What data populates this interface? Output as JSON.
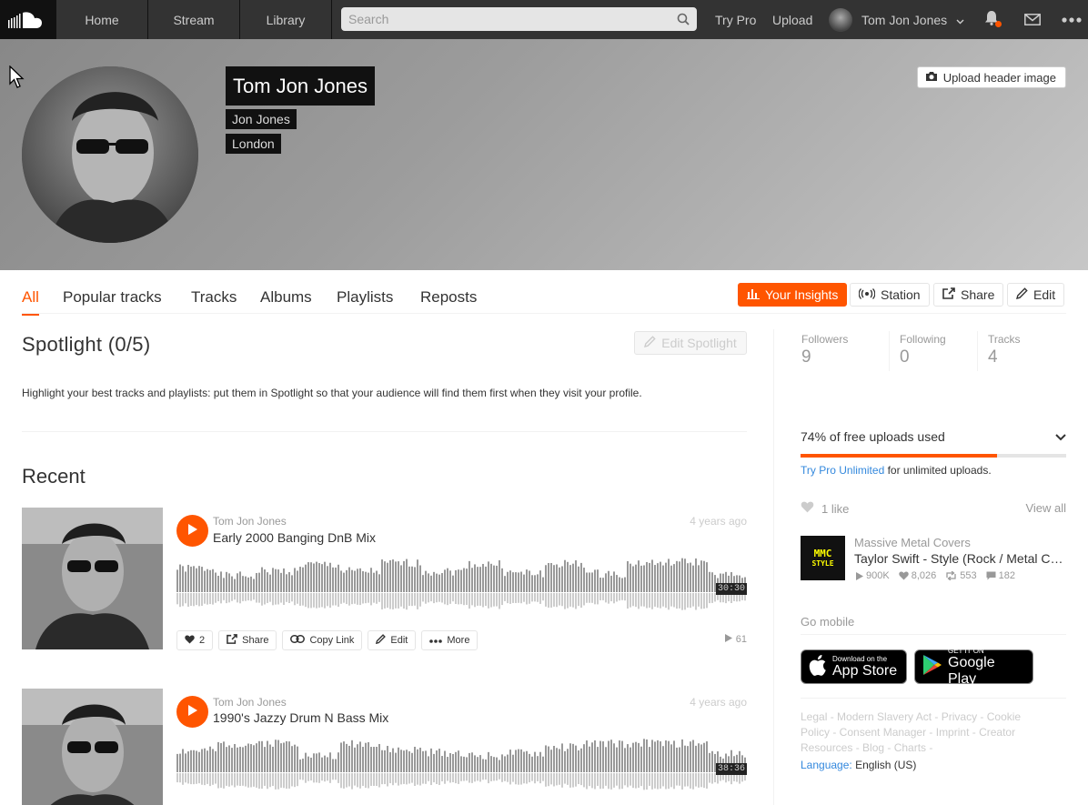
{
  "nav": {
    "home": "Home",
    "stream": "Stream",
    "library": "Library",
    "search_placeholder": "Search",
    "try_pro": "Try Pro",
    "upload": "Upload",
    "user_name": "Tom Jon Jones"
  },
  "profile": {
    "display_name": "Tom Jon Jones",
    "full_name": "Jon Jones",
    "city": "London",
    "upload_header_label": "Upload header image"
  },
  "tabs": {
    "all": "All",
    "popular": "Popular tracks",
    "tracks": "Tracks",
    "albums": "Albums",
    "playlists": "Playlists",
    "reposts": "Reposts"
  },
  "actions": {
    "insights": "Your Insights",
    "station": "Station",
    "share": "Share",
    "edit": "Edit"
  },
  "spotlight": {
    "title": "Spotlight (0/5)",
    "edit_label": "Edit Spotlight",
    "description": "Highlight your best tracks and playlists: put them in Spotlight so that your audience will find them first when they visit your profile."
  },
  "recent": {
    "title": "Recent",
    "tracks": [
      {
        "user": "Tom Jon Jones",
        "title": "Early 2000 Banging DnB Mix",
        "age": "4 years ago",
        "duration": "30:30",
        "likes": "2",
        "plays": "61",
        "share": "Share",
        "copy": "Copy Link",
        "edit": "Edit",
        "more": "More"
      },
      {
        "user": "Tom Jon Jones",
        "title": "1990's Jazzy Drum N Bass Mix",
        "age": "4 years ago",
        "duration": "38:36"
      }
    ]
  },
  "stats": {
    "followers_label": "Followers",
    "followers": "9",
    "following_label": "Following",
    "following": "0",
    "tracks_label": "Tracks",
    "tracks": "4"
  },
  "uploads": {
    "label": "74% of free uploads used",
    "percent": 74,
    "pro_link": "Try Pro Unlimited",
    "pro_suffix": "for unlimited uploads."
  },
  "likes": {
    "count_label": "1 like",
    "view_all": "View all",
    "item": {
      "art_text_1": "MMC",
      "art_text_2": "STYLE",
      "user": "Massive Metal Covers",
      "title": "Taylor Swift - Style (Rock / Metal Cover)",
      "plays": "900K",
      "likes": "8,026",
      "reposts": "553",
      "comments": "182"
    }
  },
  "mobile": {
    "title": "Go mobile",
    "appstore_small": "Download on the",
    "appstore_big": "App Store",
    "gplay_small": "GET IT ON",
    "gplay_big": "Google Play"
  },
  "footer": {
    "links": "Legal - Modern Slavery Act - Privacy - Cookie Policy - Consent Manager - Imprint - Creator Resources - Blog - Charts -",
    "language_label": "Language:",
    "language_value": "English (US)"
  },
  "colors": {
    "accent": "#ff5500",
    "topbar": "#333333",
    "link": "#3388dd"
  }
}
